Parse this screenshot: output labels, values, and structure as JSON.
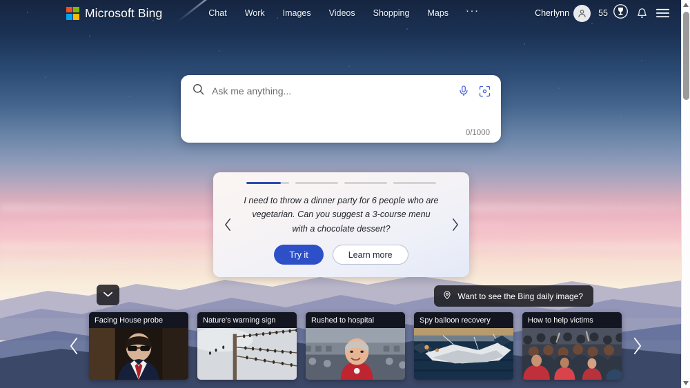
{
  "header": {
    "brand": {
      "name": "Microsoft Bing",
      "logo_icon": "microsoft-logo-icon",
      "colors": {
        "red": "#f25022",
        "green": "#7fba00",
        "blue": "#00a4ef",
        "yellow": "#ffb900"
      }
    },
    "nav": [
      {
        "label": "Chat"
      },
      {
        "label": "Work"
      },
      {
        "label": "Images"
      },
      {
        "label": "Videos"
      },
      {
        "label": "Shopping"
      },
      {
        "label": "Maps"
      }
    ],
    "more_label": "···",
    "user": {
      "name": "Cherlynn",
      "avatar_icon": "person-avatar-icon"
    },
    "rewards": {
      "count": "55",
      "icon": "rewards-trophy-icon"
    },
    "notifications_icon": "bell-icon",
    "menu_icon": "hamburger-menu-icon"
  },
  "search": {
    "placeholder": "Ask me anything...",
    "value": "",
    "counter": "0/1000",
    "search_icon": "search-icon",
    "mic_icon": "microphone-icon",
    "visual_icon": "visual-search-camera-icon"
  },
  "suggestion": {
    "text": "I need to throw a dinner party for 6 people who are vegetarian. Can you suggest a 3-course menu with a chocolate dessert?",
    "try_label": "Try it",
    "learn_label": "Learn more",
    "prev_icon": "chevron-left-icon",
    "next_icon": "chevron-right-icon",
    "progress": {
      "total": 4,
      "active_index": 0,
      "active_fill_percent": 80,
      "active_color": "#2b4ab0"
    }
  },
  "daily_image_pill": {
    "label": "Want to see the Bing daily image?",
    "icon": "location-pin-icon"
  },
  "expand_button": {
    "icon": "chevron-down-icon"
  },
  "news": {
    "prev_icon": "chevron-left-icon",
    "next_icon": "chevron-right-icon",
    "cards": [
      {
        "title": "Facing House probe",
        "thumb": "man-in-suit-glasses-hearing"
      },
      {
        "title": "Nature's warning sign",
        "thumb": "birds-on-power-lines"
      },
      {
        "title": "Rushed to hospital",
        "thumb": "man-red-shirt-stadium"
      },
      {
        "title": "Spy balloon recovery",
        "thumb": "balloon-debris-at-sea"
      },
      {
        "title": "How to help victims",
        "thumb": "crowd-of-people"
      }
    ]
  },
  "scrollbar": {
    "up_icon": "scroll-up-arrow-icon",
    "down_icon": "scroll-down-arrow-icon",
    "thumb": "scrollbar-thumb"
  }
}
